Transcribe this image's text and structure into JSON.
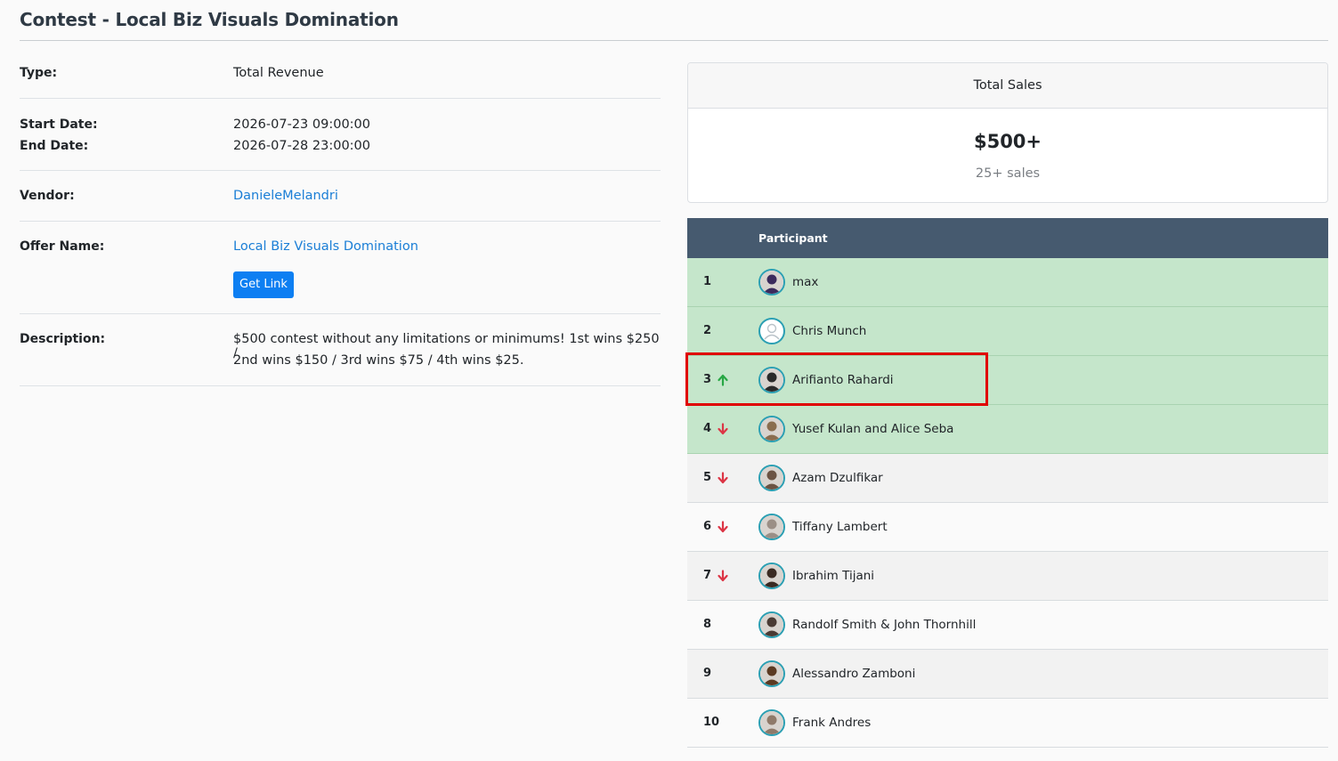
{
  "page": {
    "title": "Contest - Local Biz Visuals Domination"
  },
  "details": {
    "type_label": "Type:",
    "type_value": "Total Revenue",
    "start_label": "Start Date:",
    "start_value": "2026-07-23 09:00:00",
    "end_label": "End Date:",
    "end_value": "2026-07-28 23:00:00",
    "vendor_label": "Vendor:",
    "vendor_value": "DanieleMelandri",
    "offer_label": "Offer Name:",
    "offer_value": "Local Biz Visuals Domination",
    "get_link_label": "Get Link",
    "description_label": "Description:",
    "description_line1": "$500 contest without any limitations or minimums! 1st wins $250 /",
    "description_line2": "2nd wins $150 / 3rd wins $75 / 4th wins $25."
  },
  "summary": {
    "header": "Total Sales",
    "amount": "$500+",
    "sales": "25+ sales"
  },
  "leaderboard": {
    "column_participant": "Participant",
    "rows": [
      {
        "rank": "1",
        "trend": "none",
        "name": "max",
        "winner": true
      },
      {
        "rank": "2",
        "trend": "none",
        "name": "Chris Munch",
        "winner": true
      },
      {
        "rank": "3",
        "trend": "up",
        "name": "Arifianto Rahardi",
        "winner": true
      },
      {
        "rank": "4",
        "trend": "down",
        "name": "Yusef Kulan and Alice Seba",
        "winner": true
      },
      {
        "rank": "5",
        "trend": "down",
        "name": "Azam Dzulfikar",
        "winner": false
      },
      {
        "rank": "6",
        "trend": "down",
        "name": "Tiffany Lambert",
        "winner": false
      },
      {
        "rank": "7",
        "trend": "down",
        "name": "Ibrahim Tijani",
        "winner": false
      },
      {
        "rank": "8",
        "trend": "none",
        "name": "Randolf Smith & John Thornhill",
        "winner": false
      },
      {
        "rank": "9",
        "trend": "none",
        "name": "Alessandro Zamboni",
        "winner": false
      },
      {
        "rank": "10",
        "trend": "none",
        "name": "Frank Andres",
        "winner": false
      }
    ]
  },
  "colors": {
    "up": "#28a745",
    "down": "#dc3545",
    "highlight": "#e00000",
    "header_bg": "#465a6f",
    "winner_bg": "#c5e6cb"
  }
}
